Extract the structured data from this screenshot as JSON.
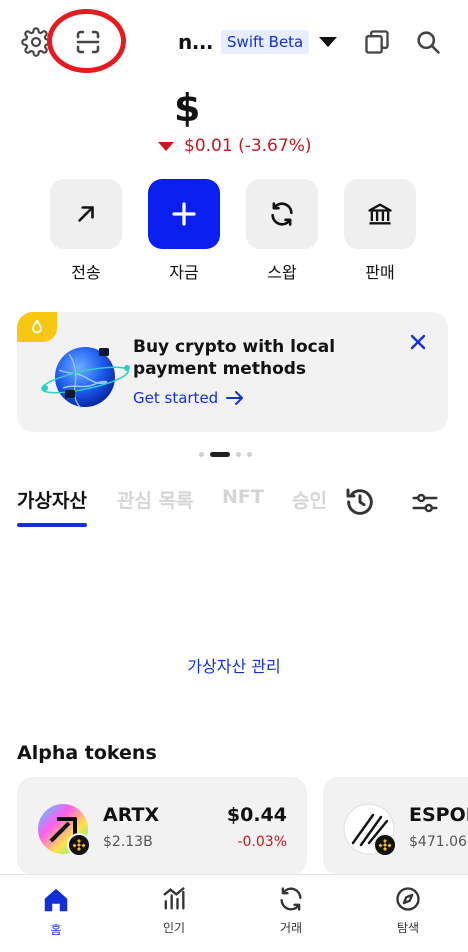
{
  "header": {
    "account_name": "n...",
    "beta_label": "Swift Beta",
    "icons": [
      "gear-icon",
      "scan-icon",
      "chevron-down-icon",
      "copy-icon",
      "search-icon"
    ]
  },
  "balance": {
    "amount": "$",
    "change": "$0.01 (-3.67%)"
  },
  "actions": [
    {
      "label": "전송",
      "icon": "send-arrow-icon"
    },
    {
      "label": "자금",
      "icon": "plus-icon"
    },
    {
      "label": "스왑",
      "icon": "swap-icon"
    },
    {
      "label": "판매",
      "icon": "bank-icon"
    }
  ],
  "promo": {
    "title": "Buy crypto with local payment methods",
    "cta": "Get started",
    "carousel_page": 2,
    "carousel_total": 4
  },
  "tabs": [
    {
      "label": "가상자산",
      "active": true
    },
    {
      "label": "관심 목록",
      "active": false
    },
    {
      "label": "NFT",
      "active": false
    },
    {
      "label": "승인",
      "active": false
    }
  ],
  "manage_link": "가상자산 관리",
  "alpha": {
    "title": "Alpha tokens",
    "tokens": [
      {
        "symbol": "ARTX",
        "market_cap": "$2.13B",
        "price": "$0.44",
        "change": "-0.03%"
      },
      {
        "symbol": "ESPOR",
        "market_cap": "$471.06"
      }
    ]
  },
  "bottom_nav": [
    {
      "label": "홈",
      "icon": "home-icon",
      "active": true
    },
    {
      "label": "인기",
      "icon": "chart-icon",
      "active": false
    },
    {
      "label": "거래",
      "icon": "swap-icon",
      "active": false
    },
    {
      "label": "탐색",
      "icon": "compass-icon",
      "active": false
    }
  ],
  "colors": {
    "accent": "#1330d6",
    "primary_button": "#0a1ef0",
    "negative": "#c7191f",
    "promo_tag": "#f6c80f",
    "annotation_ring": "#e51b1f"
  }
}
